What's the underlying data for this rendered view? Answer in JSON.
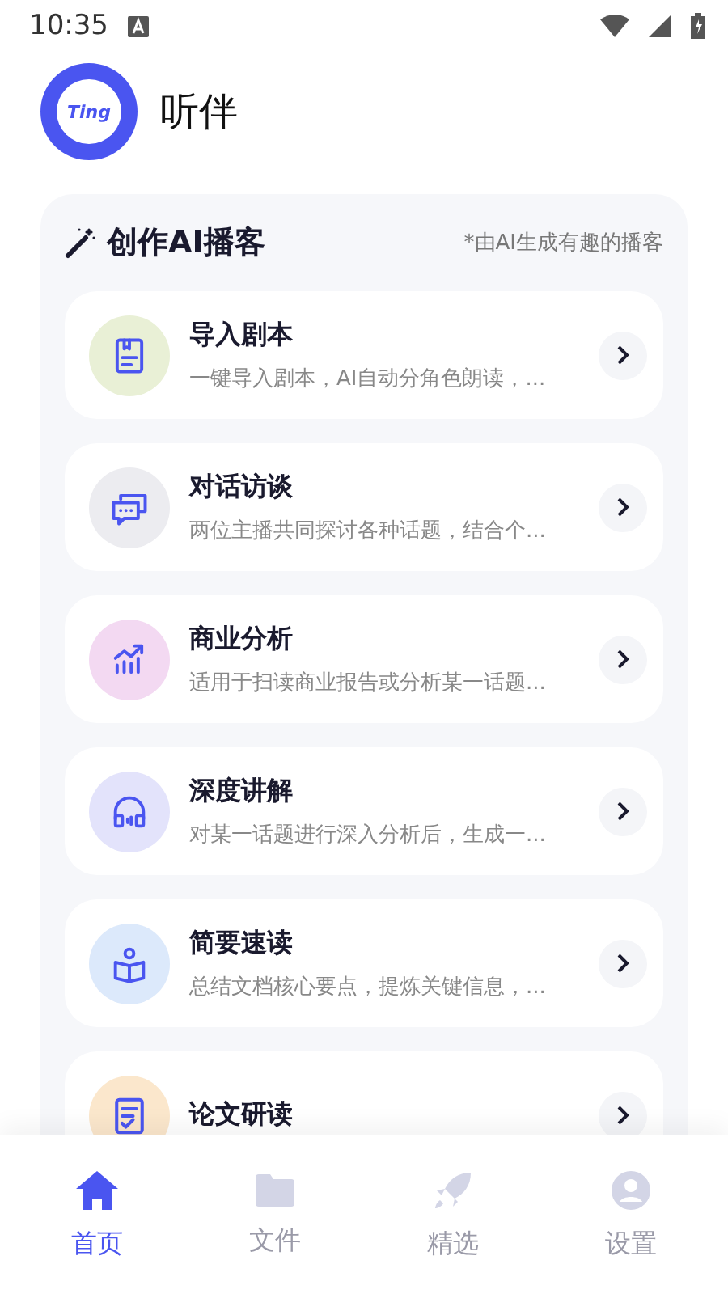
{
  "status_bar": {
    "time": "10:35"
  },
  "app": {
    "logo_text": "Ting",
    "name": "听伴"
  },
  "panel": {
    "title": "创作AI播客",
    "note": "*由AI生成有趣的播客",
    "cards": [
      {
        "kind": "script",
        "title": "导入剧本",
        "subtitle": "一键导入剧本，AI自动分角色朗读，...",
        "color": "#e9f0d6"
      },
      {
        "kind": "dialog",
        "title": "对话访谈",
        "subtitle": "两位主播共同探讨各种话题，结合个...",
        "color": "#ececf0"
      },
      {
        "kind": "chart",
        "title": "商业分析",
        "subtitle": "适用于扫读商业报告或分析某一话题...",
        "color": "#f3d9f2"
      },
      {
        "kind": "headphones",
        "title": "深度讲解",
        "subtitle": "对某一话题进行深入分析后，生成一...",
        "color": "#e3e3fb"
      },
      {
        "kind": "book",
        "title": "简要速读",
        "subtitle": "总结文档核心要点，提炼关键信息，...",
        "color": "#dce9fb"
      },
      {
        "kind": "paper",
        "title": "论文研读",
        "color": "#fbe7cc"
      }
    ]
  },
  "nav": [
    {
      "kind": "home",
      "label": "首页",
      "selected": true
    },
    {
      "kind": "folder",
      "label": "文件",
      "selected": false
    },
    {
      "kind": "rocket",
      "label": "精选",
      "selected": false
    },
    {
      "kind": "person",
      "label": "设置",
      "selected": false
    }
  ]
}
